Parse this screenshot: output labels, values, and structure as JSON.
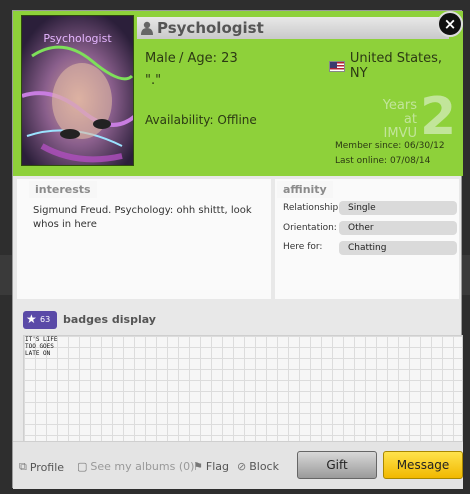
{
  "profile": {
    "username": "Psychologist",
    "photo_caption": "Psychologist",
    "gender": "Male",
    "age_label": "/ Age: 23",
    "location": "United States, NY",
    "tagline": "\".\"",
    "availability": "Availability: Offline",
    "years_label": "Years at IMVU",
    "years_value": "2",
    "member_since": "Member since: 06/30/12",
    "last_online": "Last online: 07/08/14"
  },
  "interests": {
    "title": "interests",
    "text": "Sigmund Freud. Psychology: ohh shittt, look whos in here"
  },
  "affinity": {
    "title": "affinity",
    "rows": [
      {
        "label": "Relationship:",
        "value": "Single"
      },
      {
        "label": "Orientation:",
        "value": "Other"
      },
      {
        "label": "Here for:",
        "value": "Chatting"
      }
    ]
  },
  "badges": {
    "count": "63",
    "title": "badges display",
    "badge_text": "IT'S LIFE TOO GOES LATE ON"
  },
  "footer": {
    "profile": "Profile",
    "albums": "See my albums (0)",
    "flag": "Flag",
    "block": "Block",
    "gift": "Gift",
    "message": "Message"
  },
  "colors": {
    "header_green": "#8ed13a",
    "message_yellow": "#ffd22e",
    "badge_purple": "#5a4aa7"
  }
}
